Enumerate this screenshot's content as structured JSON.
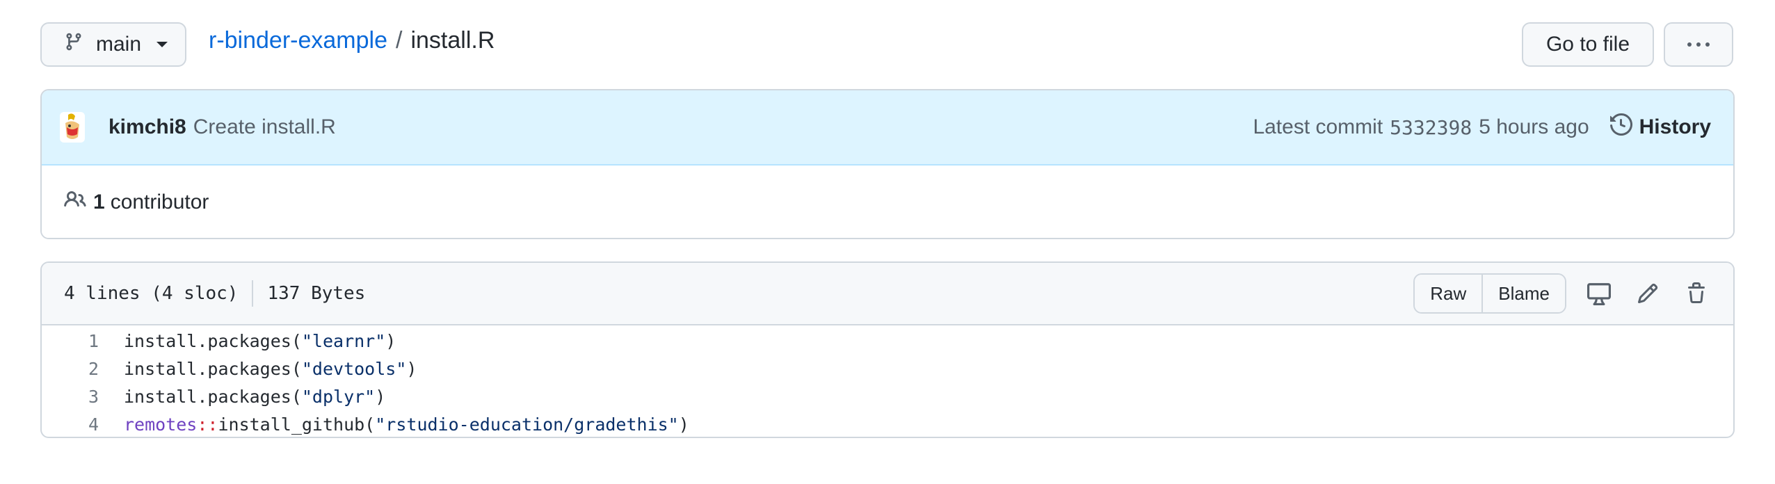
{
  "top": {
    "branch": "main",
    "repo": "r-binder-example",
    "separator": "/",
    "file": "install.R",
    "goto_label": "Go to file"
  },
  "commit": {
    "author": "kimchi8",
    "message": "Create install.R",
    "latest_label": "Latest commit",
    "sha": "5332398",
    "time": "5 hours ago",
    "history_label": "History"
  },
  "contributors": {
    "count": "1",
    "label": "contributor"
  },
  "file": {
    "lines_info": "4 lines (4 sloc)",
    "size": "137 Bytes",
    "raw_label": "Raw",
    "blame_label": "Blame"
  },
  "code": [
    {
      "n": "1",
      "fn": "install.packages(",
      "str": "\"learnr\"",
      "end": ")"
    },
    {
      "n": "2",
      "fn": "install.packages(",
      "str": "\"devtools\"",
      "end": ")"
    },
    {
      "n": "3",
      "fn": "install.packages(",
      "str": "\"dplyr\"",
      "end": ")"
    },
    {
      "n": "4",
      "ns": "remotes",
      "op": "::",
      "fn": "install_github(",
      "str": "\"rstudio-education/gradethis\"",
      "end": ")"
    }
  ],
  "icons": {
    "branch": "git-branch-icon",
    "more": "kebab-horizontal-icon",
    "history": "history-clock-icon",
    "contributors": "people-icon",
    "display": "desktop-icon",
    "edit": "pencil-icon",
    "delete": "trash-icon"
  },
  "colors": {
    "link": "#0969da",
    "commit_bg": "#ddf4ff",
    "border": "#d0d7de",
    "string": "#0a3069",
    "namespace": "#6f42c1",
    "operator": "#cf222e"
  }
}
